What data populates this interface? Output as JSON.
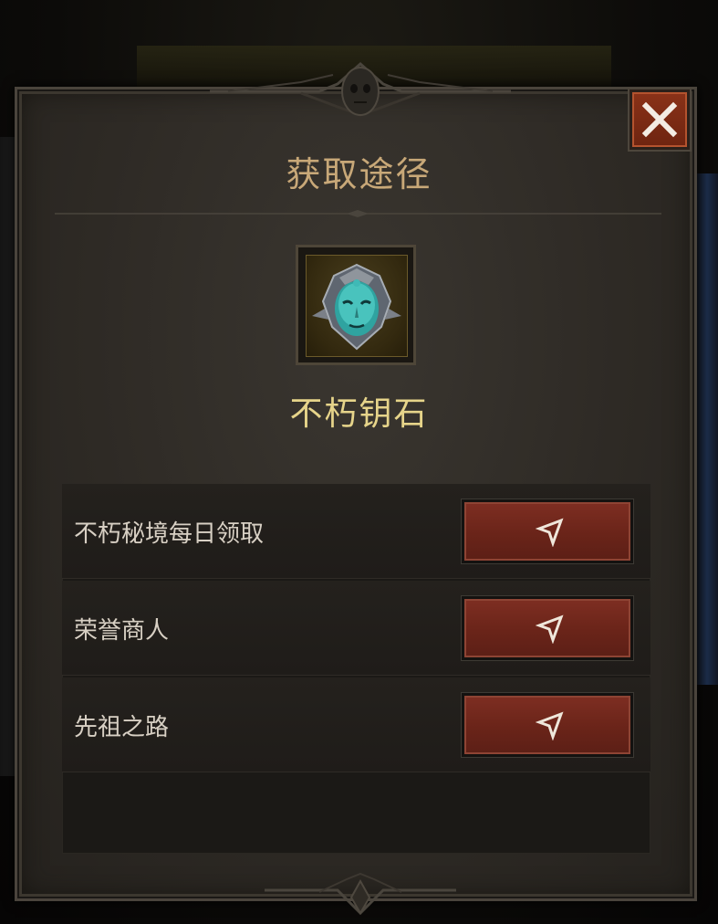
{
  "dialog": {
    "title": "获取途径",
    "close_icon": "close-x-icon"
  },
  "item": {
    "name": "不朽钥石",
    "icon": "immortal-keystone-mask-icon"
  },
  "sources": [
    {
      "label": "不朽秘境每日领取",
      "action_icon": "navigate-arrow-icon"
    },
    {
      "label": "荣誉商人",
      "action_icon": "navigate-arrow-icon"
    },
    {
      "label": "先祖之路",
      "action_icon": "navigate-arrow-icon"
    }
  ],
  "colors": {
    "title": "#c8a878",
    "item_name": "#e6d48a",
    "button": "#6a2419",
    "close_button": "#7a2c14"
  }
}
